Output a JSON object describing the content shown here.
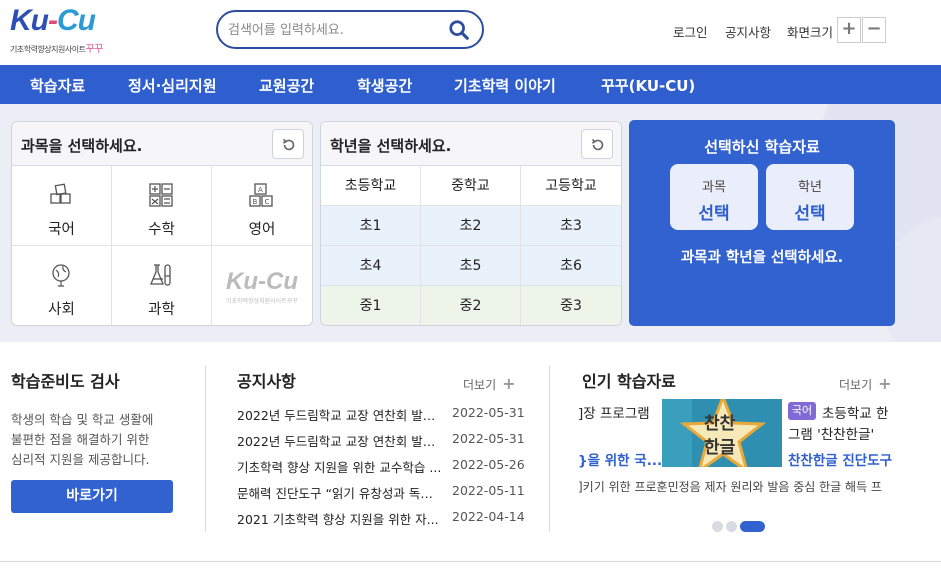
{
  "header": {
    "logo": {
      "main_k": "Ku",
      "main_dash": "-",
      "main_c": "Cu",
      "sub": "기초학력향상지원사이트",
      "sub_accent": "꾸꾸"
    },
    "search_placeholder": "검색어를 입력하세요.",
    "util": {
      "login": "로그인",
      "notice": "공지사항",
      "zoom_label": "화면크기",
      "zoom_in": "+",
      "zoom_out": "−"
    }
  },
  "nav": {
    "items": [
      "학습자료",
      "정서·심리지원",
      "교원공간",
      "학생공간",
      "기초학력 이야기",
      "꾸꾸(KU-CU)"
    ]
  },
  "subject_panel": {
    "title": "과목을 선택하세요.",
    "subjects": [
      {
        "label": "국어",
        "icon": "korean-blocks-icon"
      },
      {
        "label": "수학",
        "icon": "math-operators-icon"
      },
      {
        "label": "영어",
        "icon": "abc-blocks-icon"
      },
      {
        "label": "사회",
        "icon": "globe-icon"
      },
      {
        "label": "과학",
        "icon": "flask-icon"
      }
    ]
  },
  "grade_panel": {
    "title": "학년을 선택하세요.",
    "headers": [
      "초등학교",
      "중학교",
      "고등학교"
    ],
    "rows": [
      [
        "초1",
        "초2",
        "초3"
      ],
      [
        "초4",
        "초5",
        "초6"
      ],
      [
        "중1",
        "중2",
        "중3"
      ]
    ]
  },
  "result_panel": {
    "title": "선택하신 학습자료",
    "subject_label": "과목",
    "subject_value": "선택",
    "grade_label": "학년",
    "grade_value": "선택",
    "message": "과목과 학년을 선택하세요."
  },
  "readiness": {
    "title": "학습준비도 검사",
    "desc": [
      "학생의 학습 및 학교 생활에",
      "불편한 점을 해결하기 위한",
      "심리적 지원을 제공합니다."
    ],
    "button": "바로가기"
  },
  "notices": {
    "title": "공지사항",
    "more": "더보기",
    "items": [
      {
        "title": "2022년 두드림학교 교장 연찬회 발표...",
        "date": "2022-05-31"
      },
      {
        "title": "2022년 두드림학교 교장 연찬회 발표...",
        "date": "2022-05-31"
      },
      {
        "title": "기초학력 향상 지원을 위한 교수학습 ...",
        "date": "2022-05-26"
      },
      {
        "title": "문해력 진단도구 “읽기 유창성과 독해...",
        "date": "2022-05-11"
      },
      {
        "title": "2021 기초학력 향상 지원을 위한 자...",
        "date": "2022-04-14"
      }
    ]
  },
  "popular": {
    "title": "인기 학습자료",
    "more": "더보기",
    "left_line1": "]장 프로그램",
    "left_link": "}을 위한 국...",
    "thumb_line1": "찬찬",
    "thumb_line2": "한글",
    "badge": "국어",
    "right_title1": "초등학교 한",
    "right_title2": "그램 '찬찬한글'",
    "right_link": "찬찬한글 진단도구",
    "desc_line": "]키기 위한 프로훈민정음 제자 원리와 발음 중심 한글 해득 프"
  },
  "colors": {
    "primary": "#3262d0",
    "nav": "#2f5fcf",
    "accent_badge": "#7f6bd6",
    "link": "#2f5fcf"
  }
}
